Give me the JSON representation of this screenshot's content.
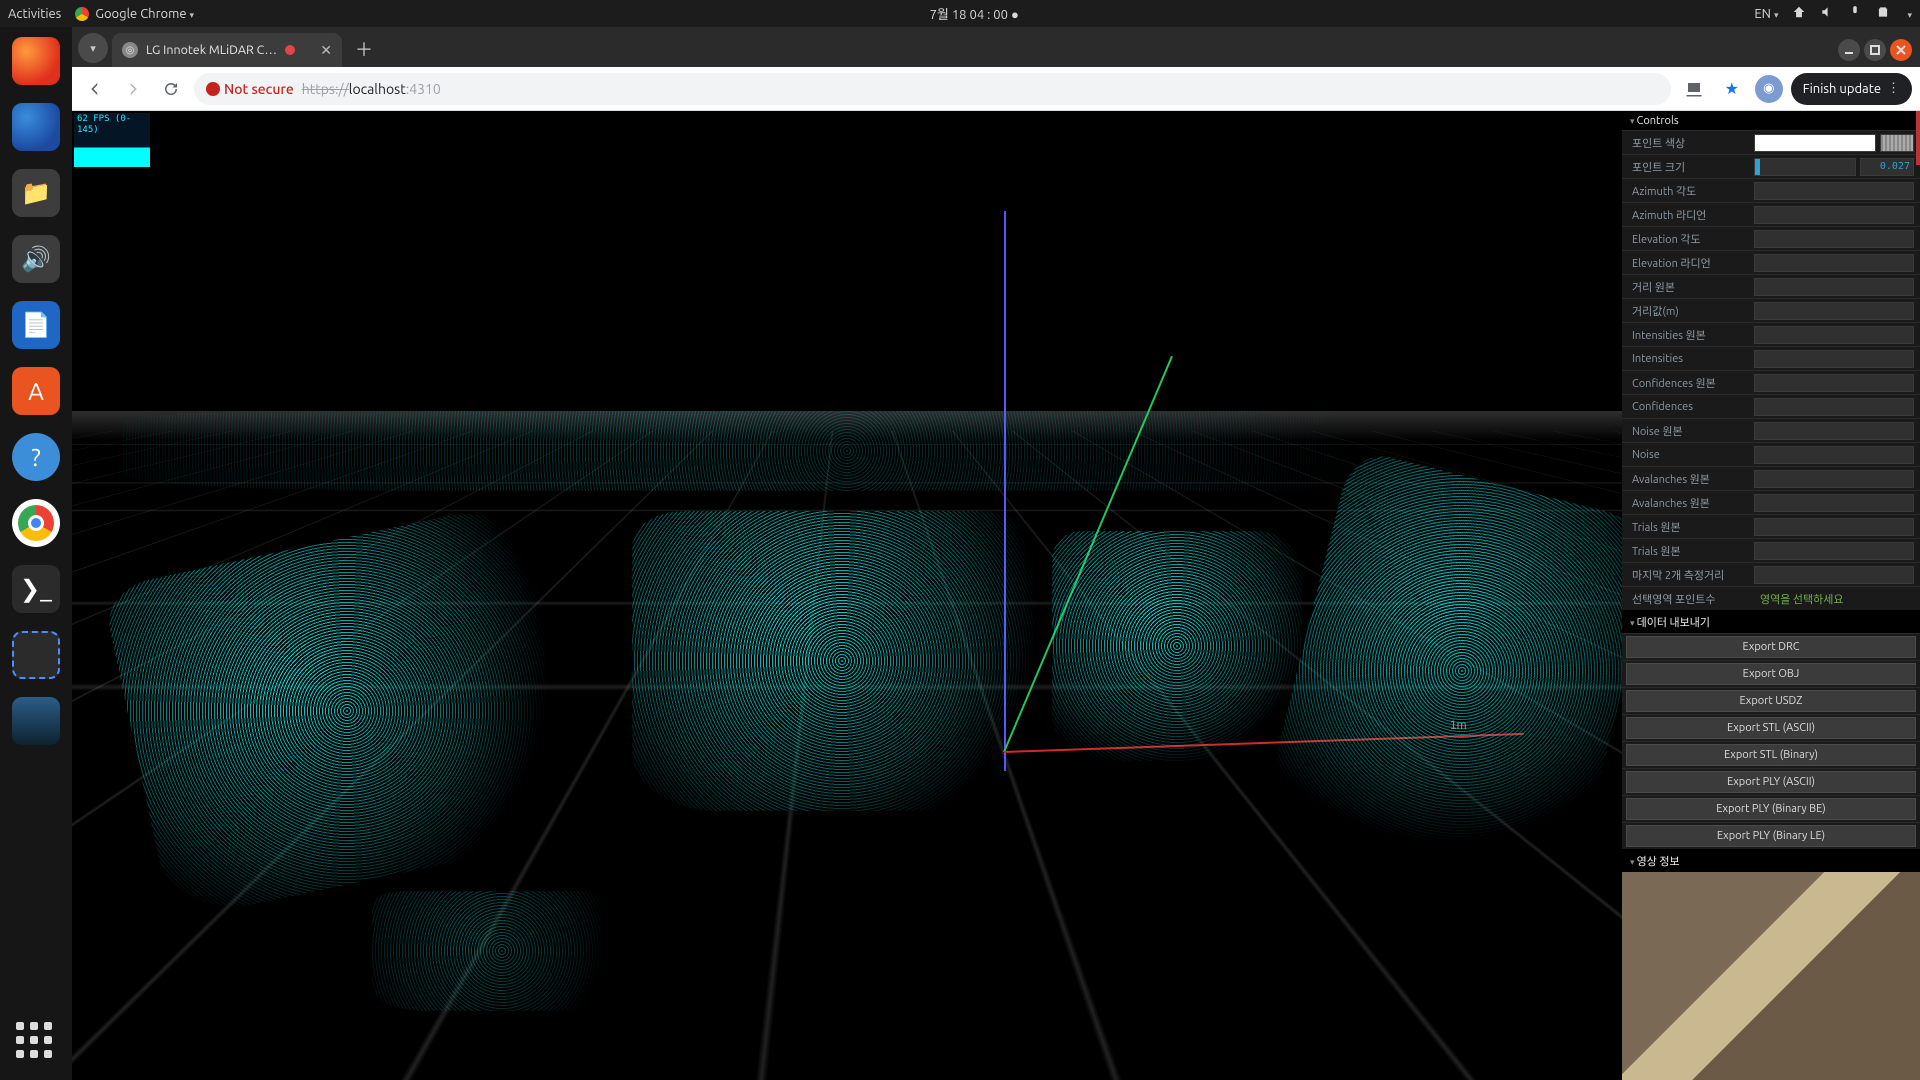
{
  "menubar": {
    "activities": "Activities",
    "app": "Google Chrome",
    "clock": "7월 18  04 : 00  ●",
    "lang": "EN"
  },
  "dock": {
    "items": [
      "firefox",
      "thunderbird",
      "files",
      "rhythmbox",
      "writer",
      "software",
      "help",
      "chrome",
      "terminal",
      "screenshot",
      "show-desktop"
    ]
  },
  "tab": {
    "title": "LG Innotek MLiDAR C…",
    "recording": true
  },
  "omnibox": {
    "notsecure": "Not secure",
    "proto": "https://",
    "host": "localhost",
    "port": ":4310",
    "finish": "Finish update"
  },
  "fps": {
    "label": "62 FPS (0-145)"
  },
  "scene": {
    "scale_label": "1m"
  },
  "panel": {
    "controls_title": "Controls",
    "point_color_label": "포인트 색상",
    "point_size": {
      "label": "포인트 크기",
      "value": "0.027",
      "pct": 5
    },
    "rows": [
      "Azimuth 각도",
      "Azimuth 라디언",
      "Elevation 각도",
      "Elevation 라디언",
      "거리 원본",
      "거리값(m)",
      "Intensities 원본",
      "Intensities",
      "Confidences 원본",
      "Confidences",
      "Noise 원본",
      "Noise",
      "Avalanches 원본",
      "Avalanches 원본",
      "Trials 원본",
      "Trials 원본"
    ],
    "last_dist": {
      "label": "마지막 2개 측정거리"
    },
    "sel_pts": {
      "label": "선택영역 포인트수",
      "hint": "영역을 선택하세요"
    },
    "export_title": "데이터 내보내기",
    "export_buttons": [
      "Export DRC",
      "Export OBJ",
      "Export USDZ",
      "Export STL (ASCII)",
      "Export STL (Binary)",
      "Export PLY (ASCII)",
      "Export PLY (Binary BE)",
      "Export PLY (Binary LE)"
    ],
    "video_title": "영상 정보"
  }
}
